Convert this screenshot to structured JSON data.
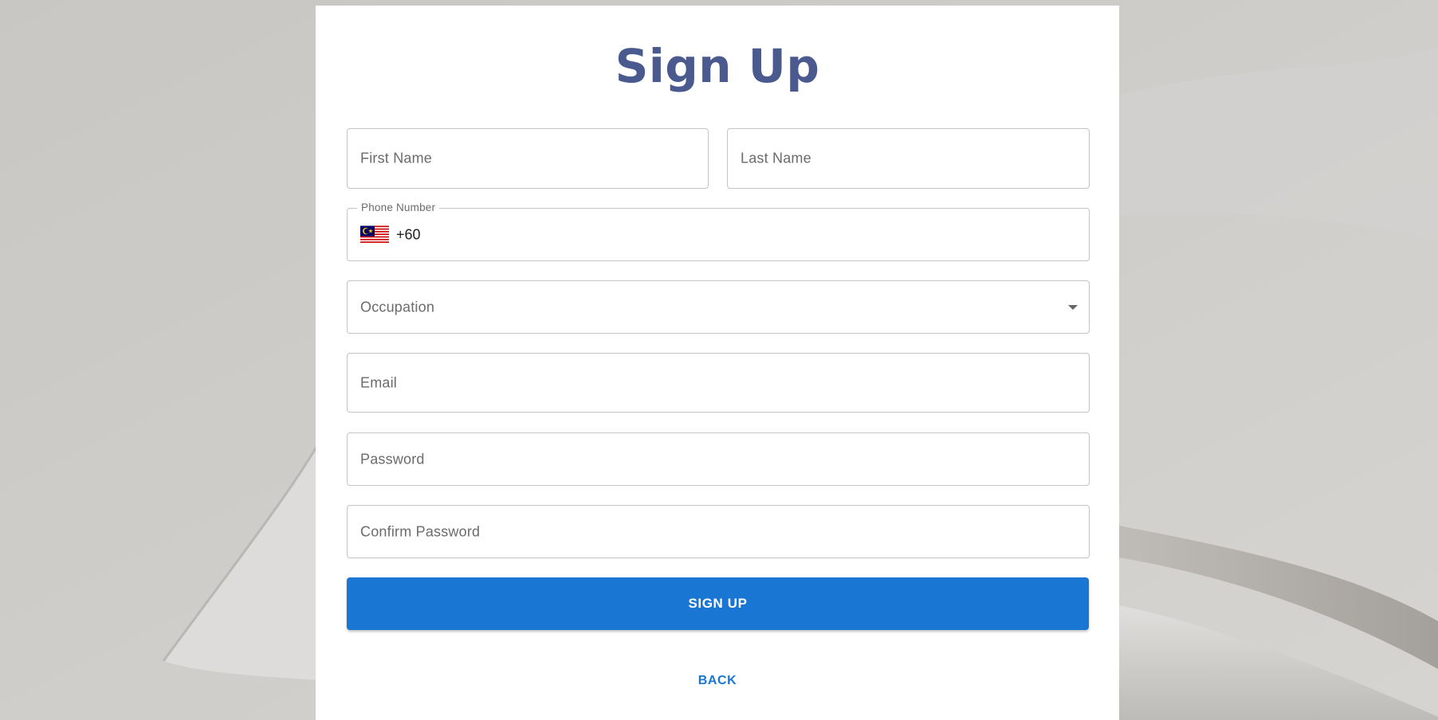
{
  "page": {
    "title": "Sign Up"
  },
  "form": {
    "first_name": {
      "placeholder": "First Name",
      "value": ""
    },
    "last_name": {
      "placeholder": "Last Name",
      "value": ""
    },
    "phone": {
      "label": "Phone Number",
      "country": "Malaysia",
      "flag_icon": "malaysia-flag-icon",
      "value": "+60"
    },
    "occupation": {
      "placeholder": "Occupation",
      "icon": "chevron-down-icon"
    },
    "email": {
      "placeholder": "Email",
      "value": ""
    },
    "password": {
      "placeholder": "Password",
      "value": ""
    },
    "confirm_password": {
      "placeholder": "Confirm Password",
      "value": ""
    }
  },
  "actions": {
    "submit_label": "SIGN UP",
    "back_label": "BACK"
  },
  "colors": {
    "title": "#4a5a8e",
    "primary": "#1976d2",
    "background": "#cfcdc9"
  }
}
